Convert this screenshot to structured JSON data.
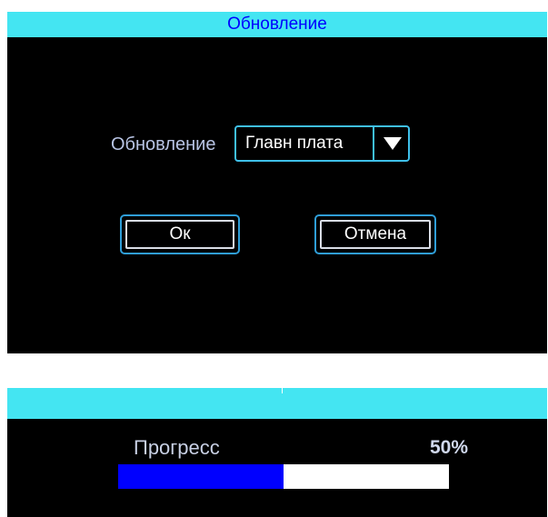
{
  "update_dialog": {
    "title": "Обновление",
    "field_label": "Обновление",
    "select_value": "Главн плата",
    "ok_label": "Ок",
    "cancel_label": "Отмена"
  },
  "progress_dialog": {
    "title": "",
    "label": "Прогресс",
    "percent_text": "50%",
    "progress_fraction": 0.5
  },
  "colors": {
    "titlebar_bg": "#44e5f2",
    "title_text": "#0000ff",
    "accent_border": "#3fc0ea",
    "progress_fill": "#0000ff",
    "progress_track": "#ffffff",
    "panel_bg": "#000000"
  },
  "icons": {
    "select_arrow": "triangle-down-icon"
  }
}
